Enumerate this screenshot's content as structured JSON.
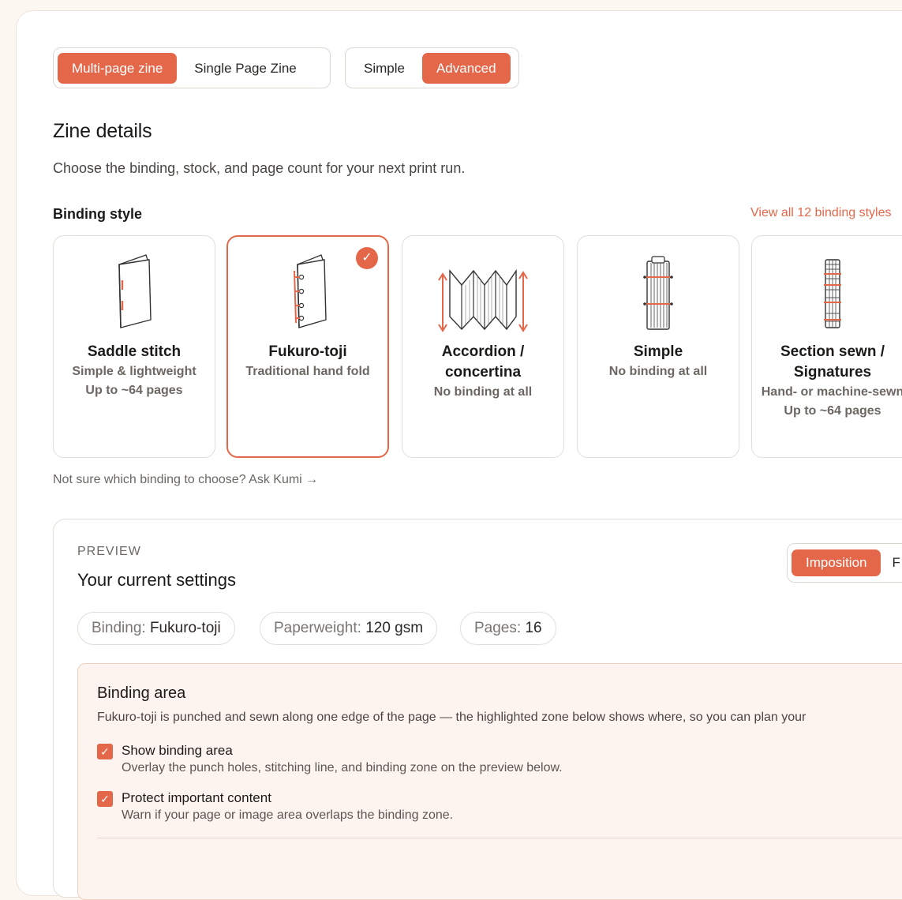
{
  "zine_type": {
    "options": [
      "Multi-page zine",
      "Single Page Zine"
    ],
    "active": "Multi-page zine"
  },
  "mode": {
    "options": [
      "Simple",
      "Advanced"
    ],
    "active": "Advanced"
  },
  "header": {
    "title": "Zine details",
    "subtitle": "Choose the binding, stock, and page count for your next print run."
  },
  "binding_style": {
    "label": "Binding style",
    "view_all": "View all 12 binding styles",
    "selected": "Fukuro-toji",
    "cards": [
      {
        "name": "Saddle stitch",
        "lines": [
          "Simple & lightweight",
          "Up to ~64 pages"
        ],
        "icon": "saddle-stitch-booklet-icon"
      },
      {
        "name": "Fukuro-toji",
        "lines": [
          "Traditional hand fold"
        ],
        "icon": "fukuro-toji-booklet-icon"
      },
      {
        "name": "Accordion / concertina",
        "lines": [
          "No binding at all"
        ],
        "icon": "accordion-fold-icon"
      },
      {
        "name": "Simple",
        "lines": [
          "No binding at all"
        ],
        "icon": "simple-stack-icon"
      },
      {
        "name": "Section sewn / Signatures",
        "lines": [
          "Hand- or machine-sewn",
          "Up to ~64 pages"
        ],
        "icon": "section-sewn-spine-icon"
      }
    ],
    "help_link": "Not sure which binding to choose? Ask Kumi →"
  },
  "preview": {
    "kicker": "PREVIEW",
    "title": "Your current settings",
    "view_toggle": {
      "options": [
        "Imposition",
        "F"
      ],
      "active": "Imposition"
    },
    "pills": [
      {
        "label": "Binding:",
        "value": "Fukuro-toji"
      },
      {
        "label": "Paperweight:",
        "value": "120 gsm"
      },
      {
        "label": "Pages:",
        "value": "16"
      }
    ],
    "binding_area": {
      "title": "Binding area",
      "description": "Fukuro-toji is punched and sewn along one edge of the page — the highlighted zone below shows where, so you can plan your",
      "options": [
        {
          "label": "Show binding area",
          "hint": "Overlay the punch holes, stitching line, and binding zone on the preview below.",
          "checked": true
        },
        {
          "label": "Protect important content",
          "hint": "Warn if your page or image area overlaps the binding zone.",
          "checked": true
        }
      ]
    }
  },
  "colors": {
    "accent": "#e5674a",
    "background": "#fdf7f1",
    "panel": "#ffffff",
    "highlight_bg": "#fdf4ef"
  }
}
